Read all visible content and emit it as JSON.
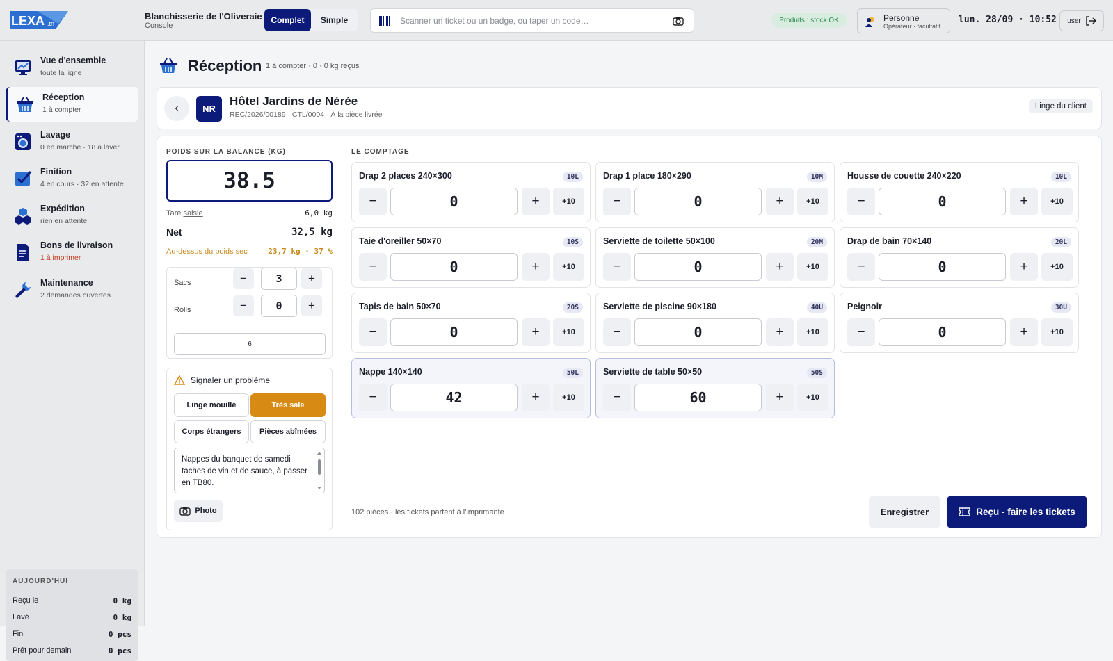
{
  "header": {
    "logo_text": "LEXA",
    "logo_suffix": ".tn",
    "app_title": "Blanchisserie de l'Oliveraie",
    "app_sub": "Console",
    "mode_full": "Complet",
    "mode_simple": "Simple",
    "search_placeholder": "Scanner un ticket ou un badge, ou taper un code…",
    "stock_status": "Produits : stock OK",
    "person_name": "Personne",
    "person_role": "Opérateur · facultatif",
    "clock": "lun. 28/09 · 10:52",
    "user_label": "user"
  },
  "sidebar": {
    "items": [
      {
        "label": "Vue d'ensemble",
        "sub": "toute la ligne"
      },
      {
        "label": "Réception",
        "sub": "1 à compter"
      },
      {
        "label": "Lavage",
        "sub": "0 en marche · 18 à laver"
      },
      {
        "label": "Finition",
        "sub": "4 en cours · 32 en attente"
      },
      {
        "label": "Expédition",
        "sub": "rien en attente"
      },
      {
        "label": "Bons de livraison",
        "sub": "1 à imprimer"
      },
      {
        "label": "Maintenance",
        "sub": "2 demandes ouvertes"
      }
    ],
    "today": {
      "title": "AUJOURD'HUI",
      "rows": [
        {
          "label": "Reçu le",
          "value": "0 kg"
        },
        {
          "label": "Lavé",
          "value": "0 kg"
        },
        {
          "label": "Fini",
          "value": "0 pcs"
        },
        {
          "label": "Prêt pour demain",
          "value": "0 pcs"
        }
      ]
    }
  },
  "page": {
    "title": "Réception",
    "meta": "1 à compter · 0 · 0 kg reçus"
  },
  "client": {
    "initials": "NR",
    "name": "Hôtel Jardins de Nérée",
    "ref": "REC/2026/00189 · CTL/0004 · À la pièce livrée",
    "linen_button": "Linge du client"
  },
  "weighing": {
    "title": "POIDS SUR LA BALANCE (KG)",
    "weight": "38.5",
    "tare_label": "Tare",
    "tare_link": "saisie",
    "tare_value": "6,0 kg",
    "net_label": "Net",
    "net_value": "32,5 kg",
    "over_label": "Au-dessus du poids sec",
    "over_value": "23,7 kg · 37 %",
    "bags_label": "Sacs",
    "bags_value": "3",
    "rolls_label": "Rolls",
    "rolls_value": "0",
    "total_value": "6"
  },
  "problem": {
    "title": "Signaler un problème",
    "chips": [
      "Linge mouillé",
      "Très sale",
      "Corps étrangers",
      "Pièces abîmées"
    ],
    "note": "Nappes du banquet de samedi : taches de vin et de sauce, à passer en TB80.",
    "photo_label": "Photo"
  },
  "counting": {
    "title": "LE COMPTAGE",
    "items": [
      {
        "name": "Drap 2 places 240×300",
        "code": "10L",
        "count": "0"
      },
      {
        "name": "Drap 1 place 180×290",
        "code": "10M",
        "count": "0"
      },
      {
        "name": "Housse de couette 240×220",
        "code": "10L",
        "count": "0"
      },
      {
        "name": "Taie d'oreiller 50×70",
        "code": "10S",
        "count": "0"
      },
      {
        "name": "Serviette de toilette 50×100",
        "code": "20M",
        "count": "0"
      },
      {
        "name": "Drap de bain 70×140",
        "code": "20L",
        "count": "0"
      },
      {
        "name": "Tapis de bain 50×70",
        "code": "20S",
        "count": "0"
      },
      {
        "name": "Serviette de piscine 90×180",
        "code": "40U",
        "count": "0"
      },
      {
        "name": "Peignoir",
        "code": "30U",
        "count": "0"
      },
      {
        "name": "Nappe 140×140",
        "code": "50L",
        "count": "42"
      },
      {
        "name": "Serviette de table 50×50",
        "code": "50S",
        "count": "60"
      }
    ],
    "minus": "−",
    "plus": "+",
    "plus_ten": "+10",
    "footer": "102 pièces · les tickets partent à l'imprimante",
    "save": "Enregistrer",
    "submit": "Reçu - faire les tickets"
  },
  "colors": {
    "brand": "#0c1a7a",
    "warning": "#d88b14",
    "ok": "#2b8a4f",
    "alert": "#c63b22"
  }
}
